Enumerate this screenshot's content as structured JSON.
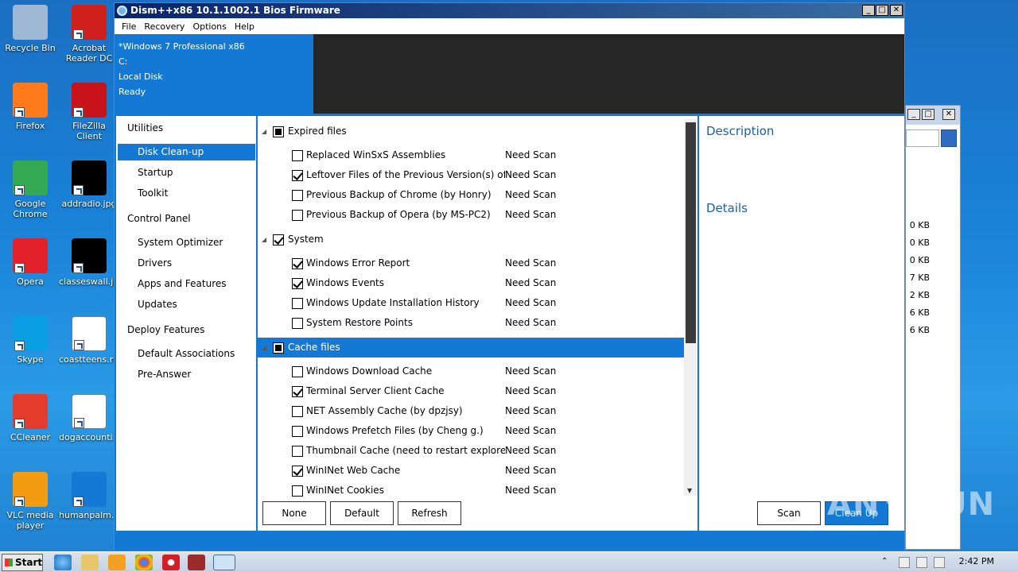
{
  "desktop_icons": [
    {
      "label": "Recycle Bin",
      "color": "#9fb8d6"
    },
    {
      "label": "Acrobat Reader DC",
      "color": "#d0201c"
    },
    {
      "label": "Firefox",
      "color": "#ff7a1a"
    },
    {
      "label": "FileZilla Client",
      "color": "#c8131a"
    },
    {
      "label": "Google Chrome",
      "color": "#34a853"
    },
    {
      "label": "addradio.jpg",
      "color": "#000000"
    },
    {
      "label": "Opera",
      "color": "#e3212a"
    },
    {
      "label": "classeswall.jpg",
      "color": "#000000"
    },
    {
      "label": "Skype",
      "color": "#0a9fe3"
    },
    {
      "label": "coastteens.rtf",
      "color": "#ffffff"
    },
    {
      "label": "CCleaner",
      "color": "#e33b2c"
    },
    {
      "label": "dogaccounti...",
      "color": "#ffffff"
    },
    {
      "label": "VLC media player",
      "color": "#f39c12"
    },
    {
      "label": "humanpalm...",
      "color": "#1479d4"
    }
  ],
  "window": {
    "title": "Dism++x86 10.1.1002.1 Bios Firmware",
    "menu": [
      "File",
      "Recovery",
      "Options",
      "Help"
    ],
    "header": {
      "os": "*Windows 7 Professional x86",
      "drive": "C:",
      "disk": "Local Disk",
      "status": "Ready"
    }
  },
  "nav": {
    "groups": [
      {
        "title": "Utilities",
        "items": [
          "Disk Clean-up",
          "Startup",
          "Toolkit"
        ]
      },
      {
        "title": "Control Panel",
        "items": [
          "System Optimizer",
          "Drivers",
          "Apps and Features",
          "Updates"
        ]
      },
      {
        "title": "Deploy Features",
        "items": [
          "Default Associations",
          "Pre-Answer"
        ]
      }
    ],
    "selected": "Disk Clean-up"
  },
  "cleanup": {
    "status_text": "Need Scan",
    "categories": [
      {
        "name": "Expired files",
        "state": "partial",
        "items": [
          {
            "name": "Replaced WinSxS Assemblies",
            "checked": false
          },
          {
            "name": "Leftover Files of the Previous Version(s) of Dism++",
            "checked": true
          },
          {
            "name": "Previous Backup of Chrome (by Honry)",
            "checked": false
          },
          {
            "name": "Previous Backup of Opera (by MS-PC2)",
            "checked": false
          }
        ]
      },
      {
        "name": "System",
        "state": "checked",
        "items": [
          {
            "name": "Windows Error Report",
            "checked": true
          },
          {
            "name": "Windows Events",
            "checked": true
          },
          {
            "name": "Windows Update Installation History",
            "checked": false
          },
          {
            "name": "System Restore Points",
            "checked": false
          }
        ]
      },
      {
        "name": "Cache files",
        "state": "partial",
        "selected": true,
        "items": [
          {
            "name": "Windows Download Cache",
            "checked": false
          },
          {
            "name": "Terminal Server Client Cache",
            "checked": true
          },
          {
            "name": "NET Assembly Cache (by dpzjsy)",
            "checked": false
          },
          {
            "name": "Windows Prefetch Files (by Cheng g.)",
            "checked": false
          },
          {
            "name": "Thumbnail Cache (need to restart explorer)",
            "checked": false
          },
          {
            "name": "WinINet Web Cache",
            "checked": true
          },
          {
            "name": "WinINet Cookies",
            "checked": false
          }
        ]
      }
    ]
  },
  "buttons": {
    "none": "None",
    "default": "Default",
    "refresh": "Refresh",
    "scan": "Scan",
    "cleanup": "Clean Up"
  },
  "right_panel": {
    "description": "Description",
    "details": "Details"
  },
  "back_window": {
    "sizes": [
      "0 KB",
      "0 KB",
      "0 KB",
      "7 KB",
      "2 KB",
      "6 KB",
      "6 KB"
    ]
  },
  "taskbar": {
    "start": "Start",
    "time": "2:42 PM"
  },
  "watermark": "ANY RUN"
}
